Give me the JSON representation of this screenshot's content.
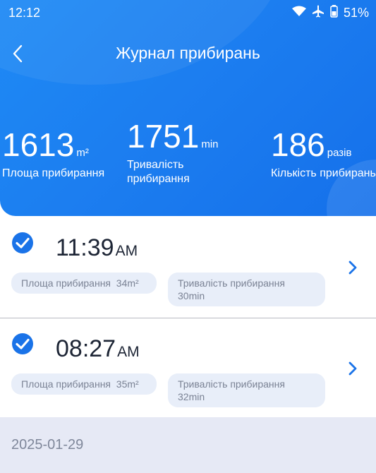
{
  "status_bar": {
    "time": "12:12",
    "battery": "51%"
  },
  "header": {
    "title": "Журнал прибирань"
  },
  "stats": {
    "area": {
      "value": "1613",
      "unit": "m²",
      "label": "Площа прибирання"
    },
    "duration": {
      "value": "1751",
      "unit": "min",
      "label": "Тривалість прибирання"
    },
    "count": {
      "value": "186",
      "unit": "разів",
      "label": "Кількість прибирань"
    }
  },
  "records": [
    {
      "time": "11:39",
      "ampm": "AM",
      "area_label": "Площа прибирання",
      "area_value": "34m²",
      "duration_label": "Тривалість прибирання",
      "duration_value": "30min"
    },
    {
      "time": "08:27",
      "ampm": "AM",
      "area_label": "Площа прибирання",
      "area_value": "35m²",
      "duration_label": "Тривалість прибирання",
      "duration_value": "32min"
    }
  ],
  "date_header": "2025-01-29",
  "colors": {
    "accent": "#1c7ef0",
    "check": "#1a73e8",
    "text_dark": "#1d2535",
    "pill_bg": "#e8eef9",
    "date_bg": "#e6e9f5"
  }
}
